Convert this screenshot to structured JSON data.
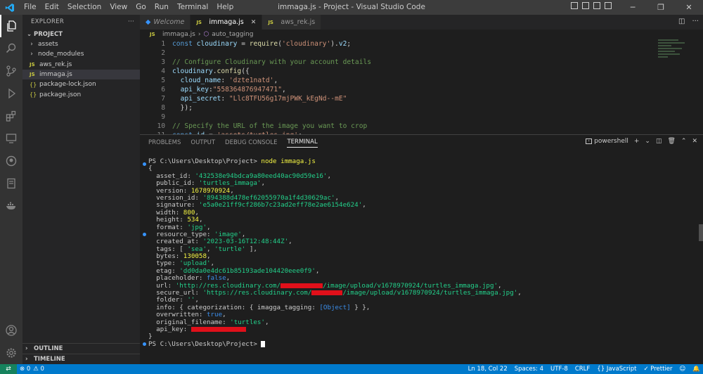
{
  "window": {
    "title": "immaga.js - Project - Visual Studio Code",
    "menu": [
      "File",
      "Edit",
      "Selection",
      "View",
      "Go",
      "Run",
      "Terminal",
      "Help"
    ],
    "controls": [
      "─",
      "❐",
      "✕"
    ]
  },
  "sidebar": {
    "header": "EXPLORER",
    "more": "···",
    "section": "PROJECT",
    "items": [
      {
        "label": "assets",
        "kind": "folder"
      },
      {
        "label": "node_modules",
        "kind": "folder"
      },
      {
        "label": "aws_rek.js",
        "kind": "js"
      },
      {
        "label": "immaga.js",
        "kind": "js"
      },
      {
        "label": "package-lock.json",
        "kind": "json"
      },
      {
        "label": "package.json",
        "kind": "json"
      }
    ],
    "outline": "OUTLINE",
    "timeline": "TIMELINE"
  },
  "tabs": [
    {
      "label": "Welcome",
      "active": false,
      "close": ""
    },
    {
      "label": "immaga.js",
      "active": true,
      "close": "✕"
    },
    {
      "label": "aws_rek.js",
      "active": false,
      "close": ""
    }
  ],
  "breadcrumb": {
    "file": "immaga.js",
    "separator": "›",
    "symbol": "auto_tagging"
  },
  "editor": {
    "lines": [
      {
        "n": "1",
        "tokens": [
          [
            "kw",
            "const "
          ],
          [
            "var",
            "cloudinary"
          ],
          [
            "punc",
            " = "
          ],
          [
            "fn",
            "require"
          ],
          [
            "punc",
            "("
          ],
          [
            "str",
            "'cloudinary'"
          ],
          [
            "punc",
            ")."
          ],
          [
            "var",
            "v2"
          ],
          [
            "punc",
            ";"
          ]
        ]
      },
      {
        "n": "2",
        "tokens": []
      },
      {
        "n": "3",
        "tokens": [
          [
            "cm",
            "// Configure Cloudinary with your account details"
          ]
        ]
      },
      {
        "n": "4",
        "tokens": [
          [
            "var",
            "cloudinary"
          ],
          [
            "punc",
            "."
          ],
          [
            "fn",
            "config"
          ],
          [
            "punc",
            "({"
          ]
        ]
      },
      {
        "n": "5",
        "tokens": [
          [
            "punc",
            "  "
          ],
          [
            "var",
            "cloud_name"
          ],
          [
            "punc",
            ": "
          ],
          [
            "str",
            "'dzte1natd'"
          ],
          [
            "punc",
            ","
          ]
        ]
      },
      {
        "n": "6",
        "tokens": [
          [
            "punc",
            "  "
          ],
          [
            "var",
            "api_key"
          ],
          [
            "punc",
            ":"
          ],
          [
            "str",
            "\"558364876947471\""
          ],
          [
            "punc",
            ","
          ]
        ]
      },
      {
        "n": "7",
        "tokens": [
          [
            "punc",
            "  "
          ],
          [
            "var",
            "api_secret"
          ],
          [
            "punc",
            ": "
          ],
          [
            "str",
            "\"Llc8TFU56g17mjPWK_kEgNd--mE\""
          ]
        ]
      },
      {
        "n": "8",
        "tokens": [
          [
            "punc",
            "  });"
          ]
        ]
      },
      {
        "n": "9",
        "tokens": []
      },
      {
        "n": "10",
        "tokens": [
          [
            "cm",
            "// Specify the URL of the image you want to crop"
          ]
        ]
      },
      {
        "n": "11",
        "tokens": [
          [
            "kw",
            "const "
          ],
          [
            "var",
            "id"
          ],
          [
            "punc",
            " = "
          ],
          [
            "str",
            "'assets/turtles.jpg'"
          ],
          [
            "punc",
            ";"
          ]
        ]
      }
    ]
  },
  "panel": {
    "tabs": [
      "PROBLEMS",
      "OUTPUT",
      "DEBUG CONSOLE",
      "TERMINAL"
    ],
    "active_tab": "TERMINAL",
    "shell": "powershell",
    "actions": [
      "+",
      "⌄",
      "◫",
      "🗑",
      "⌃",
      "✕"
    ]
  },
  "terminal": {
    "lines": [
      [
        [
          "prompt",
          "PS C:\\Users\\Desktop\\Project> "
        ],
        [
          "cmd",
          "node immaga.js"
        ]
      ],
      [
        [
          "plain",
          "{"
        ]
      ],
      [
        [
          "plain",
          "  asset_id: "
        ],
        [
          "str",
          "'432538e94bdca9a80eed40ac90d59e16'"
        ],
        [
          "plain",
          ","
        ]
      ],
      [
        [
          "plain",
          "  public_id: "
        ],
        [
          "str",
          "'turtles_immaga'"
        ],
        [
          "plain",
          ","
        ]
      ],
      [
        [
          "plain",
          "  version: "
        ],
        [
          "num",
          "1678970924"
        ],
        [
          "plain",
          ","
        ]
      ],
      [
        [
          "plain",
          "  version_id: "
        ],
        [
          "str",
          "'894388d478ef62055970a1f4d30629ac'"
        ],
        [
          "plain",
          ","
        ]
      ],
      [
        [
          "plain",
          "  signature: "
        ],
        [
          "str",
          "'e5a0e21ff9cf286b7c23ad2eff78e2ae6154e624'"
        ],
        [
          "plain",
          ","
        ]
      ],
      [
        [
          "plain",
          "  width: "
        ],
        [
          "num",
          "800"
        ],
        [
          "plain",
          ","
        ]
      ],
      [
        [
          "plain",
          "  height: "
        ],
        [
          "num",
          "534"
        ],
        [
          "plain",
          ","
        ]
      ],
      [
        [
          "plain",
          "  format: "
        ],
        [
          "str",
          "'jpg'"
        ],
        [
          "plain",
          ","
        ]
      ],
      [
        [
          "plain",
          "  resource_type: "
        ],
        [
          "str",
          "'image'"
        ],
        [
          "plain",
          ","
        ]
      ],
      [
        [
          "plain",
          "  created_at: "
        ],
        [
          "str",
          "'2023-03-16T12:48:44Z'"
        ],
        [
          "plain",
          ","
        ]
      ],
      [
        [
          "plain",
          "  tags: [ "
        ],
        [
          "str",
          "'sea'"
        ],
        [
          "plain",
          ", "
        ],
        [
          "str",
          "'turtle'"
        ],
        [
          "plain",
          " ],"
        ]
      ],
      [
        [
          "plain",
          "  bytes: "
        ],
        [
          "num",
          "130058"
        ],
        [
          "plain",
          ","
        ]
      ],
      [
        [
          "plain",
          "  type: "
        ],
        [
          "str",
          "'upload'"
        ],
        [
          "plain",
          ","
        ]
      ],
      [
        [
          "plain",
          "  etag: "
        ],
        [
          "str",
          "'dd0da0e4dc61b85193ade104420eee0f9'"
        ],
        [
          "plain",
          ","
        ]
      ],
      [
        [
          "plain",
          "  placeholder: "
        ],
        [
          "kw",
          "false"
        ],
        [
          "plain",
          ","
        ]
      ],
      [
        [
          "plain",
          "  url: "
        ],
        [
          "str",
          "'http://res.cloudinary.com/"
        ],
        [
          "redact",
          "60"
        ],
        [
          "str",
          "/image/upload/v1678970924/turtles_immaga.jpg'"
        ],
        [
          "plain",
          ","
        ]
      ],
      [
        [
          "plain",
          "  secure_url: "
        ],
        [
          "str",
          "'https://res.cloudinary.com/"
        ],
        [
          "redact",
          "44"
        ],
        [
          "str",
          "/image/upload/v1678970924/turtles_immaga.jpg'"
        ],
        [
          "plain",
          ","
        ]
      ],
      [
        [
          "plain",
          "  folder: "
        ],
        [
          "str",
          "''"
        ],
        [
          "plain",
          ","
        ]
      ],
      [
        [
          "plain",
          "  info: { categorization: { imagga_tagging: "
        ],
        [
          "kw",
          "[Object]"
        ],
        [
          "plain",
          " } },"
        ]
      ],
      [
        [
          "plain",
          "  overwritten: "
        ],
        [
          "kw",
          "true"
        ],
        [
          "plain",
          ","
        ]
      ],
      [
        [
          "plain",
          "  original_filename: "
        ],
        [
          "str",
          "'turtles'"
        ],
        [
          "plain",
          ","
        ]
      ],
      [
        [
          "plain",
          "  api_key: "
        ],
        [
          "redact",
          "78"
        ]
      ],
      [
        [
          "plain",
          "}"
        ]
      ],
      [
        [
          "prompt",
          "PS C:\\Users\\Desktop\\Project> "
        ],
        [
          "cursor",
          ""
        ]
      ]
    ]
  },
  "status": {
    "errors": "⊗ 0",
    "warnings": "⚠ 0",
    "position": "Ln 18, Col 22",
    "spaces": "Spaces: 4",
    "encoding": "UTF-8",
    "eol": "CRLF",
    "language": "JavaScript",
    "formatter": "✓ Prettier"
  },
  "colors": {
    "accent": "#007acc",
    "redaction": "#e0101a"
  }
}
